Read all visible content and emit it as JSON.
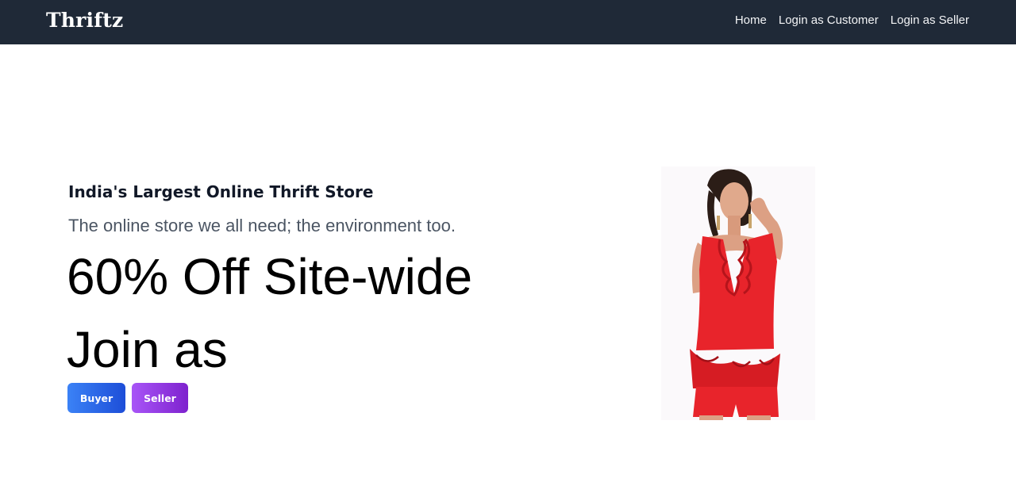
{
  "navbar": {
    "brand": "Thriftz",
    "links": [
      {
        "label": "Home"
      },
      {
        "label": "Login as Customer"
      },
      {
        "label": "Login as Seller"
      }
    ]
  },
  "hero": {
    "heading": "India's Largest Online Thrift Store",
    "subheading": "The online store we all need; the environment too.",
    "offer": "60% Off Site-wide",
    "join": "Join as",
    "buttons": {
      "buyer": "Buyer",
      "seller": "Seller"
    },
    "image_description": "woman-in-red-dress"
  },
  "colors": {
    "navbar_bg": "#1f2937",
    "buyer_button": "#2563eb",
    "seller_button": "#9333ea",
    "dress": "#e8242b"
  }
}
